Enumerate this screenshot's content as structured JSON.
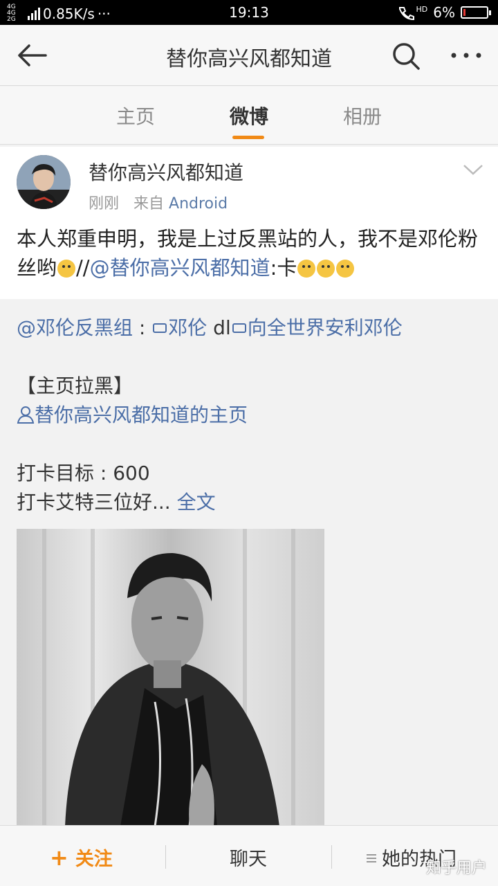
{
  "status_bar": {
    "network": "4G 4G 2G",
    "speed": "0.85K/s",
    "dots": "···",
    "time": "19:13",
    "hd": "HD",
    "battery": "6%",
    "battery_level": 0.06
  },
  "header": {
    "title": "替你高兴风都知道"
  },
  "tabs": [
    {
      "label": "主页",
      "active": false
    },
    {
      "label": "微博",
      "active": true
    },
    {
      "label": "相册",
      "active": false
    }
  ],
  "post": {
    "author": "替你高兴风都知道",
    "time": "刚刚",
    "source_prefix": "来自",
    "source": "Android",
    "text_main": "本人郑重申明，我是上过反黑站的人，我不是邓伦粉丝哟",
    "text_sep": "//",
    "mention": "@替你高兴风都知道",
    "text_tail": ":卡"
  },
  "repost": {
    "mention": "@邓伦反黑组",
    "colon": " :",
    "tag1": "邓伦",
    "tag1_suffix": " dl",
    "tag2": "向全世界安利邓伦",
    "section": "【主页拉黑】",
    "home_link": "替你高兴风都知道的主页",
    "goal": "打卡目标 : 600",
    "more_text": "打卡艾特三位好...",
    "full_text": "全文"
  },
  "bottom_bar": {
    "follow": "关注",
    "follow_plus": "+",
    "chat": "聊天",
    "hot": "她的热门"
  },
  "watermark": "知乎用户",
  "colors": {
    "accent": "#f18a16",
    "link": "#4b6ea7"
  }
}
